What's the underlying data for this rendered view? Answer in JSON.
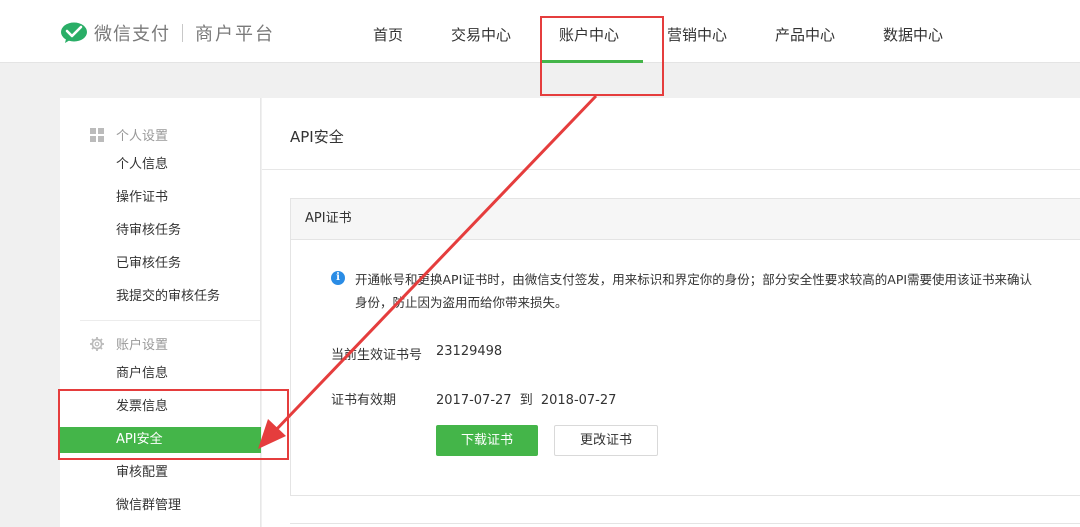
{
  "header": {
    "brand": "微信支付",
    "product": "商户平台",
    "nav": [
      {
        "label": "首页"
      },
      {
        "label": "交易中心"
      },
      {
        "label": "账户中心"
      },
      {
        "label": "营销中心"
      },
      {
        "label": "产品中心"
      },
      {
        "label": "数据中心"
      }
    ],
    "active_nav": "账户中心"
  },
  "sidebar": {
    "groups": [
      {
        "title": "个人设置",
        "icon": "grid-icon",
        "items": [
          "个人信息",
          "操作证书",
          "待审核任务",
          "已审核任务",
          "我提交的审核任务"
        ]
      },
      {
        "title": "账户设置",
        "icon": "gear-icon",
        "items": [
          "商户信息",
          "发票信息",
          "API安全",
          "审核配置",
          "微信群管理"
        ]
      }
    ],
    "active_item": "API安全"
  },
  "main": {
    "title": "API安全",
    "card": {
      "title": "API证书",
      "notice_line1": "开通帐号和更换API证书时，由微信支付签发，用来标识和界定你的身份；部分安全性要求较高的API需要使用该证书来确认",
      "notice_line2": "身份，防止因为盗用而给你带来损失。",
      "serial_label": "当前生效证书号",
      "serial_value": "23129498",
      "validity_label": "证书有效期",
      "valid_from": "2017-07-27",
      "valid_to_word": "到",
      "valid_to": "2018-07-27",
      "download_button": "下载证书",
      "change_button": "更改证书"
    }
  },
  "colors": {
    "accent": "#44b549",
    "annotation": "#e53d3d",
    "info": "#2a8ce5"
  }
}
